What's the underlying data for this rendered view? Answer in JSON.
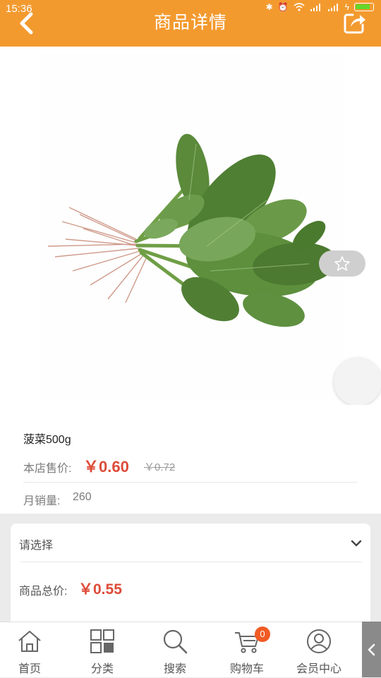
{
  "status_bar": {
    "time": "15:36"
  },
  "header": {
    "title": "商品详情",
    "back_icon": "chevron-left-icon",
    "share_icon": "share-icon"
  },
  "product": {
    "name": "菠菜500g",
    "price_label": "本店售价:",
    "price": "￥0.60",
    "original_price": "￥0.72",
    "sales_label": "月销量:",
    "sales": "260"
  },
  "spec": {
    "select_label": "请选择",
    "total_label": "商品总价:",
    "total_price": "￥0.55"
  },
  "tabbar": {
    "items": [
      {
        "label": "首页",
        "icon": "home-icon"
      },
      {
        "label": "分类",
        "icon": "grid-icon"
      },
      {
        "label": "搜索",
        "icon": "search-icon"
      },
      {
        "label": "购物车",
        "icon": "cart-icon"
      },
      {
        "label": "会员中心",
        "icon": "user-icon"
      }
    ],
    "cart_count": "0"
  },
  "colors": {
    "brand": "#f39a2f",
    "price": "#dd4b39",
    "badge": "#f15a24"
  }
}
